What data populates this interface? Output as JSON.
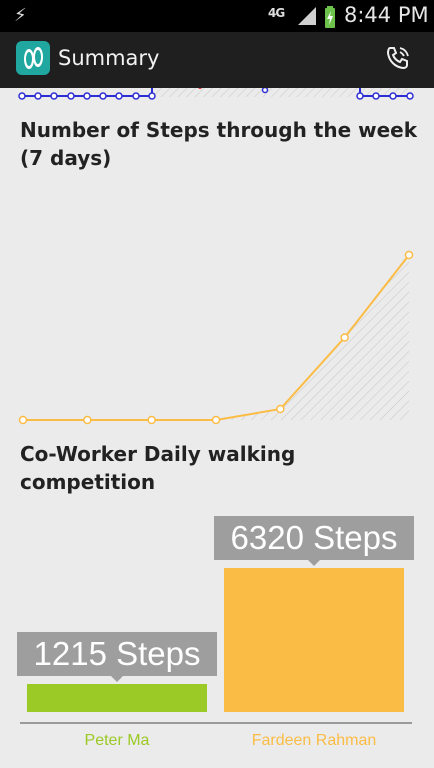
{
  "status_bar": {
    "network": "4G",
    "time": "8:44 PM"
  },
  "action_bar": {
    "title": "Summary",
    "app_icon": "footprints-icon",
    "action_icon": "phone-icon"
  },
  "steps_week": {
    "heading": "Number of Steps through the week (7 days)"
  },
  "competition": {
    "heading": "Co-Worker Daily walking competition"
  },
  "colors": {
    "line": "#fbbc45",
    "green": "#9bc926",
    "orange": "#fbbc45",
    "top_series": "#2d2dd6"
  },
  "chart_data": [
    {
      "type": "line",
      "title": "Number of Steps through the week (7 days)",
      "x": [
        1,
        2,
        3,
        4,
        5,
        6,
        7
      ],
      "values": [
        0,
        0,
        0,
        0,
        200,
        1500,
        3000
      ],
      "ylim": [
        0,
        3000
      ],
      "area_fill": "hatched"
    },
    {
      "type": "bar",
      "title": "Co-Worker Daily walking competition",
      "categories": [
        "Peter Ma",
        "Fardeen Rahman"
      ],
      "values": [
        1215,
        6320
      ],
      "labels": [
        "1215 Steps",
        "6320 Steps"
      ],
      "ylim": [
        0,
        6320
      ]
    }
  ]
}
